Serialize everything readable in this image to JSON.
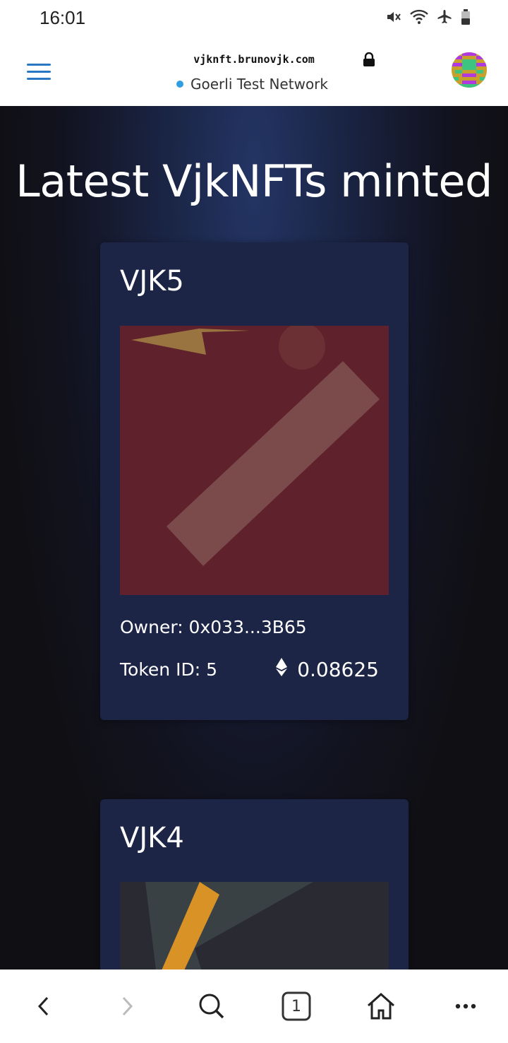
{
  "status_bar": {
    "time": "16:01",
    "icons": [
      "mute-icon",
      "wifi-icon",
      "airplane-icon",
      "battery-icon"
    ]
  },
  "browser": {
    "url": "vjknft.brunovjk.com",
    "network": "Goerli Test Network",
    "network_dot_color": "#2f9de0"
  },
  "page": {
    "title": "Latest VjkNFTs minted"
  },
  "cards": [
    {
      "name": "VJK5",
      "owner": "Owner: 0x033...3B65",
      "token_id": "Token ID: 5",
      "price": "0.08625"
    },
    {
      "name": "VJK4"
    }
  ],
  "bottom_nav": {
    "items": [
      "back-icon",
      "forward-icon",
      "search-icon",
      "tabs-icon",
      "home-icon",
      "more-icon"
    ],
    "tab_count": "1"
  }
}
